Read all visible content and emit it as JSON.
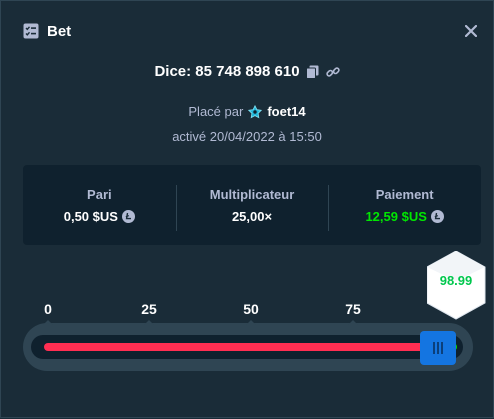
{
  "header": {
    "title": "Bet",
    "icon": "bet-list-icon",
    "close_icon": "close-icon"
  },
  "game": {
    "label": "Dice: 85 748 898 610",
    "copy_icon": "copy-icon",
    "link_icon": "link-icon"
  },
  "placed": {
    "prefix": "Placé par",
    "icon": "star-icon",
    "username": "foet14"
  },
  "activated": {
    "text": "activé 20/04/2022 à 15:50"
  },
  "stats": {
    "bet": {
      "label": "Pari",
      "value": "0,50 $US",
      "coin": "litecoin-icon"
    },
    "multiplier": {
      "label": "Multiplicateur",
      "value": "25,00×"
    },
    "payout": {
      "label": "Paiement",
      "value": "12,59 $US",
      "coin": "litecoin-icon"
    }
  },
  "slider": {
    "ticks": [
      "0",
      "25",
      "50",
      "75"
    ],
    "roll_result": "98.99",
    "threshold_fraction": 0.96
  },
  "colors": {
    "background": "#1a2c38",
    "panel": "#0f212e",
    "lose": "#ff2e52",
    "win": "#00e701",
    "handle": "#1475e1"
  }
}
